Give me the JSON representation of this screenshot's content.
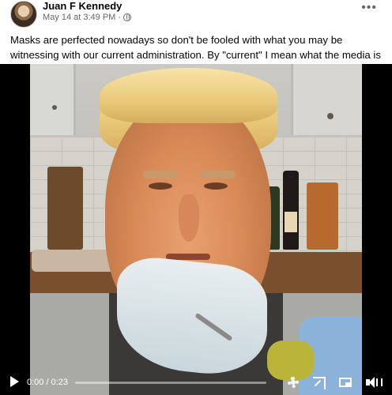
{
  "post": {
    "author": "Juan F Kennedy",
    "timestamp": "May 14 at 3:49 PM",
    "separator": "·",
    "text": "Masks are perfected nowadays so don't be fooled with what you may be witnessing with our current administration. By \"current\" I mean what the media is telling us😂🤣😂",
    "more_label": "•••",
    "privacy_icon": "globe-icon"
  },
  "video": {
    "time_display": "0:00 / 0:23",
    "progress": 0,
    "controls": [
      "play-icon",
      "settings-gear-icon",
      "expand-icon",
      "picture-in-picture-icon",
      "volume-icon"
    ]
  },
  "colors": {
    "text_primary": "#050505",
    "text_secondary": "#65676b",
    "video_bg": "#000000"
  }
}
